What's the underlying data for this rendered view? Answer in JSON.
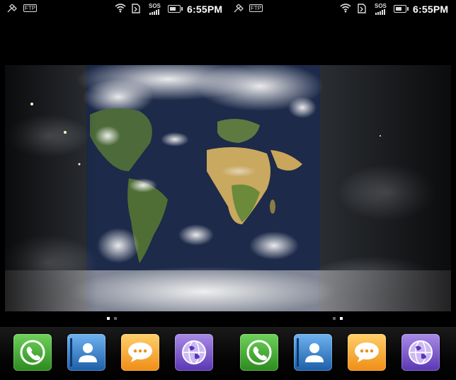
{
  "status_bar": {
    "left": {
      "ftp_label": "FTP",
      "sos_label": "SOS",
      "time": "6:55PM",
      "icons": [
        "satellite-icon",
        "ftp-icon",
        "wifi-icon",
        "sd-card-icon",
        "sos-signal-icon",
        "battery-icon"
      ]
    },
    "right": {
      "ftp_label": "FTP",
      "sos_label": "SOS",
      "time": "6:55PM",
      "icons": [
        "satellite-icon",
        "ftp-icon",
        "wifi-icon",
        "sd-card-icon",
        "sos-signal-icon",
        "battery-icon"
      ]
    }
  },
  "wallpaper": {
    "description_icon": "world-map-wallpaper"
  },
  "page_indicators": {
    "left": {
      "active": 0,
      "count": 2
    },
    "right": {
      "active": 1,
      "count": 2
    }
  },
  "dock": {
    "left": [
      {
        "name": "phone-icon"
      },
      {
        "name": "contacts-icon"
      },
      {
        "name": "messaging-icon"
      },
      {
        "name": "browser-icon"
      }
    ],
    "right": [
      {
        "name": "phone-icon"
      },
      {
        "name": "contacts-icon"
      },
      {
        "name": "messaging-icon"
      },
      {
        "name": "browser-icon"
      }
    ]
  },
  "colors": {
    "phone": "#3aa52a",
    "contacts": "#2f7fd0",
    "messaging": "#f5a324",
    "browser": "#7a55cc"
  }
}
